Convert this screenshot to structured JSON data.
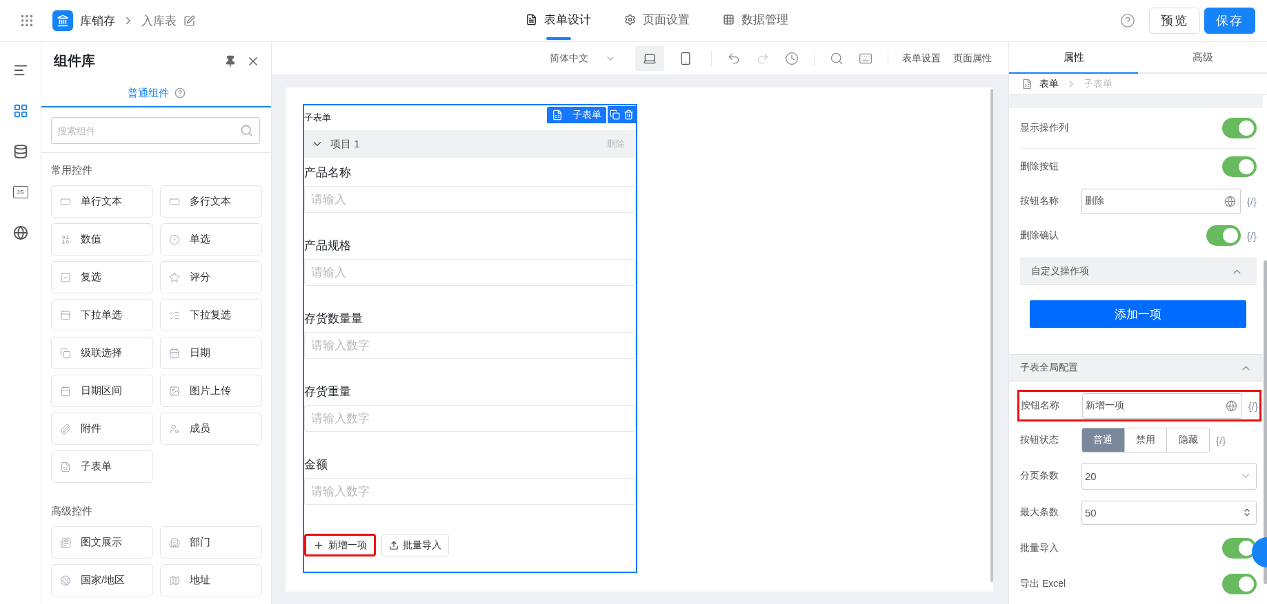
{
  "topbar": {
    "app_name": "库销存",
    "page_name": "入库表",
    "tabs": [
      {
        "label": "表单设计",
        "selected": true
      },
      {
        "label": "页面设置",
        "selected": false
      },
      {
        "label": "数据管理",
        "selected": false
      }
    ],
    "actions": [
      {
        "label": "预览",
        "kind": "default"
      },
      {
        "label": "保存",
        "kind": "primary"
      }
    ]
  },
  "rail": [
    {
      "selected": false
    },
    {
      "selected": true
    },
    {
      "selected": false
    },
    {
      "label": "JS",
      "selected": false
    },
    {
      "selected": false
    }
  ],
  "library": {
    "title": "组件库",
    "tabs": [
      {
        "label": "普通组件",
        "selected": true
      }
    ],
    "search": {
      "placeholder": "搜索组件"
    },
    "groups": [
      {
        "title": "常用控件",
        "items": [
          {
            "label": "单行文本"
          },
          {
            "label": "多行文本"
          },
          {
            "label": "数值"
          },
          {
            "label": "单选"
          },
          {
            "label": "复选"
          },
          {
            "label": "评分"
          },
          {
            "label": "下拉单选"
          },
          {
            "label": "下拉复选"
          },
          {
            "label": "级联选择"
          },
          {
            "label": "日期"
          },
          {
            "label": "日期区间"
          },
          {
            "label": "图片上传"
          },
          {
            "label": "附件"
          },
          {
            "label": "成员"
          },
          {
            "label": "子表单"
          }
        ]
      },
      {
        "title": "高级控件",
        "items": [
          {
            "label": "图文展示"
          },
          {
            "label": "部门"
          },
          {
            "label": "国家/地区"
          },
          {
            "label": "地址"
          }
        ]
      }
    ]
  },
  "canvas": {
    "toolbar": {
      "language": "简体中文",
      "devices": [
        {
          "kind": "desktop",
          "selected": true
        },
        {
          "kind": "mobile",
          "selected": false
        }
      ],
      "links": [
        "表单设置",
        "页面属性"
      ]
    },
    "subform": {
      "label": "子表单",
      "tag": "子表单",
      "item": {
        "title": "项目 1",
        "delete": "删除",
        "expanded": true
      },
      "fields": [
        {
          "label": "产品名称",
          "placeholder": "请输入"
        },
        {
          "label": "产品规格",
          "placeholder": "请输入"
        },
        {
          "label": "存货数量量",
          "placeholder": "请输入数字"
        },
        {
          "label": "存货重量",
          "placeholder": "请输入数字"
        },
        {
          "label": "金额",
          "placeholder": "请输入数字"
        }
      ],
      "buttons": [
        {
          "label": "新增一项",
          "kind": "add",
          "highlighted": true
        },
        {
          "label": "批量导入",
          "kind": "import",
          "highlighted": false
        }
      ]
    }
  },
  "props": {
    "tabs": [
      {
        "label": "属性",
        "selected": true
      },
      {
        "label": "高级",
        "selected": false
      }
    ],
    "breadcrumb": [
      "表单",
      "子表单"
    ],
    "rows": [
      {
        "kind": "switch",
        "label": "显示操作列",
        "on": true,
        "divider": true
      },
      {
        "kind": "switch",
        "label": "删除按钮",
        "on": true
      },
      {
        "kind": "text",
        "label": "按钮名称",
        "value": "删除",
        "expression": "{/}"
      },
      {
        "kind": "switch",
        "label": "删除确认",
        "on": true,
        "expression": "{/}"
      },
      {
        "kind": "section",
        "label": "自定义操作项",
        "expanded": true
      },
      {
        "kind": "button",
        "label": "添加一项"
      },
      {
        "kind": "group",
        "label": "子表全局配置",
        "expanded": true
      },
      {
        "kind": "text",
        "label": "按钮名称",
        "value": "新增一项",
        "expression": "{/}",
        "highlighted": true
      },
      {
        "kind": "segmented",
        "label": "按钮状态",
        "options": [
          {
            "label": "普通",
            "selected": true
          },
          {
            "label": "禁用",
            "selected": false
          },
          {
            "label": "隐藏",
            "selected": false
          }
        ],
        "expression": "{/}"
      },
      {
        "kind": "select",
        "label": "分页条数",
        "value": "20"
      },
      {
        "kind": "number",
        "label": "最大条数",
        "value": "50"
      },
      {
        "kind": "switch",
        "label": "批量导入",
        "on": true
      },
      {
        "kind": "switch",
        "label": "导出 Excel",
        "on": true
      }
    ]
  }
}
